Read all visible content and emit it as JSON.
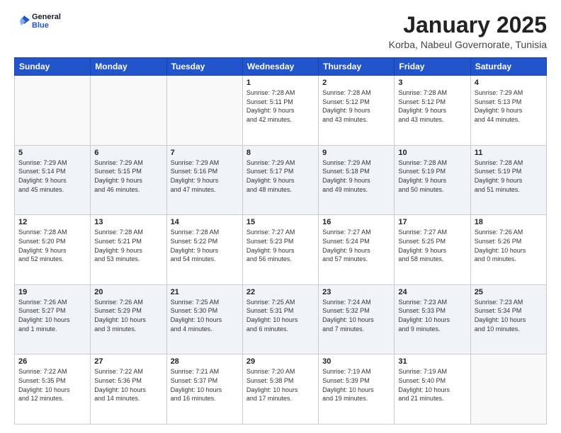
{
  "header": {
    "logo_general": "General",
    "logo_blue": "Blue",
    "title": "January 2025",
    "location": "Korba, Nabeul Governorate, Tunisia"
  },
  "days_of_week": [
    "Sunday",
    "Monday",
    "Tuesday",
    "Wednesday",
    "Thursday",
    "Friday",
    "Saturday"
  ],
  "weeks": [
    [
      {
        "day": "",
        "info": ""
      },
      {
        "day": "",
        "info": ""
      },
      {
        "day": "",
        "info": ""
      },
      {
        "day": "1",
        "info": "Sunrise: 7:28 AM\nSunset: 5:11 PM\nDaylight: 9 hours\nand 42 minutes."
      },
      {
        "day": "2",
        "info": "Sunrise: 7:28 AM\nSunset: 5:12 PM\nDaylight: 9 hours\nand 43 minutes."
      },
      {
        "day": "3",
        "info": "Sunrise: 7:28 AM\nSunset: 5:12 PM\nDaylight: 9 hours\nand 43 minutes."
      },
      {
        "day": "4",
        "info": "Sunrise: 7:29 AM\nSunset: 5:13 PM\nDaylight: 9 hours\nand 44 minutes."
      }
    ],
    [
      {
        "day": "5",
        "info": "Sunrise: 7:29 AM\nSunset: 5:14 PM\nDaylight: 9 hours\nand 45 minutes."
      },
      {
        "day": "6",
        "info": "Sunrise: 7:29 AM\nSunset: 5:15 PM\nDaylight: 9 hours\nand 46 minutes."
      },
      {
        "day": "7",
        "info": "Sunrise: 7:29 AM\nSunset: 5:16 PM\nDaylight: 9 hours\nand 47 minutes."
      },
      {
        "day": "8",
        "info": "Sunrise: 7:29 AM\nSunset: 5:17 PM\nDaylight: 9 hours\nand 48 minutes."
      },
      {
        "day": "9",
        "info": "Sunrise: 7:29 AM\nSunset: 5:18 PM\nDaylight: 9 hours\nand 49 minutes."
      },
      {
        "day": "10",
        "info": "Sunrise: 7:28 AM\nSunset: 5:19 PM\nDaylight: 9 hours\nand 50 minutes."
      },
      {
        "day": "11",
        "info": "Sunrise: 7:28 AM\nSunset: 5:19 PM\nDaylight: 9 hours\nand 51 minutes."
      }
    ],
    [
      {
        "day": "12",
        "info": "Sunrise: 7:28 AM\nSunset: 5:20 PM\nDaylight: 9 hours\nand 52 minutes."
      },
      {
        "day": "13",
        "info": "Sunrise: 7:28 AM\nSunset: 5:21 PM\nDaylight: 9 hours\nand 53 minutes."
      },
      {
        "day": "14",
        "info": "Sunrise: 7:28 AM\nSunset: 5:22 PM\nDaylight: 9 hours\nand 54 minutes."
      },
      {
        "day": "15",
        "info": "Sunrise: 7:27 AM\nSunset: 5:23 PM\nDaylight: 9 hours\nand 56 minutes."
      },
      {
        "day": "16",
        "info": "Sunrise: 7:27 AM\nSunset: 5:24 PM\nDaylight: 9 hours\nand 57 minutes."
      },
      {
        "day": "17",
        "info": "Sunrise: 7:27 AM\nSunset: 5:25 PM\nDaylight: 9 hours\nand 58 minutes."
      },
      {
        "day": "18",
        "info": "Sunrise: 7:26 AM\nSunset: 5:26 PM\nDaylight: 10 hours\nand 0 minutes."
      }
    ],
    [
      {
        "day": "19",
        "info": "Sunrise: 7:26 AM\nSunset: 5:27 PM\nDaylight: 10 hours\nand 1 minute."
      },
      {
        "day": "20",
        "info": "Sunrise: 7:26 AM\nSunset: 5:29 PM\nDaylight: 10 hours\nand 3 minutes."
      },
      {
        "day": "21",
        "info": "Sunrise: 7:25 AM\nSunset: 5:30 PM\nDaylight: 10 hours\nand 4 minutes."
      },
      {
        "day": "22",
        "info": "Sunrise: 7:25 AM\nSunset: 5:31 PM\nDaylight: 10 hours\nand 6 minutes."
      },
      {
        "day": "23",
        "info": "Sunrise: 7:24 AM\nSunset: 5:32 PM\nDaylight: 10 hours\nand 7 minutes."
      },
      {
        "day": "24",
        "info": "Sunrise: 7:23 AM\nSunset: 5:33 PM\nDaylight: 10 hours\nand 9 minutes."
      },
      {
        "day": "25",
        "info": "Sunrise: 7:23 AM\nSunset: 5:34 PM\nDaylight: 10 hours\nand 10 minutes."
      }
    ],
    [
      {
        "day": "26",
        "info": "Sunrise: 7:22 AM\nSunset: 5:35 PM\nDaylight: 10 hours\nand 12 minutes."
      },
      {
        "day": "27",
        "info": "Sunrise: 7:22 AM\nSunset: 5:36 PM\nDaylight: 10 hours\nand 14 minutes."
      },
      {
        "day": "28",
        "info": "Sunrise: 7:21 AM\nSunset: 5:37 PM\nDaylight: 10 hours\nand 16 minutes."
      },
      {
        "day": "29",
        "info": "Sunrise: 7:20 AM\nSunset: 5:38 PM\nDaylight: 10 hours\nand 17 minutes."
      },
      {
        "day": "30",
        "info": "Sunrise: 7:19 AM\nSunset: 5:39 PM\nDaylight: 10 hours\nand 19 minutes."
      },
      {
        "day": "31",
        "info": "Sunrise: 7:19 AM\nSunset: 5:40 PM\nDaylight: 10 hours\nand 21 minutes."
      },
      {
        "day": "",
        "info": ""
      }
    ]
  ]
}
